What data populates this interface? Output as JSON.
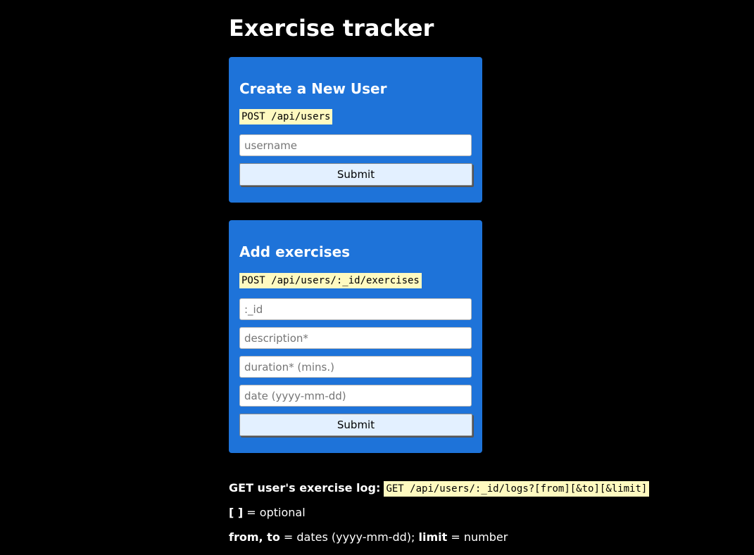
{
  "header": {
    "title": "Exercise tracker"
  },
  "create_user": {
    "heading": "Create a New User",
    "endpoint": "POST /api/users",
    "username_placeholder": "username",
    "submit_label": "Submit"
  },
  "add_exercises": {
    "heading": "Add exercises",
    "endpoint": "POST /api/users/:_id/exercises",
    "id_placeholder": ":_id",
    "description_placeholder": "description*",
    "duration_placeholder": "duration* (mins.)",
    "date_placeholder": "date (yyyy-mm-dd)",
    "submit_label": "Submit"
  },
  "log_info": {
    "label": "GET user's exercise log:",
    "endpoint": "GET /api/users/:_id/logs?[from][&to][&limit]",
    "optional_symbol": "[ ]",
    "optional_text": "= optional",
    "from_to_label": "from, to",
    "from_to_text": "= dates (yyyy-mm-dd);",
    "limit_label": "limit",
    "limit_text": "= number"
  }
}
